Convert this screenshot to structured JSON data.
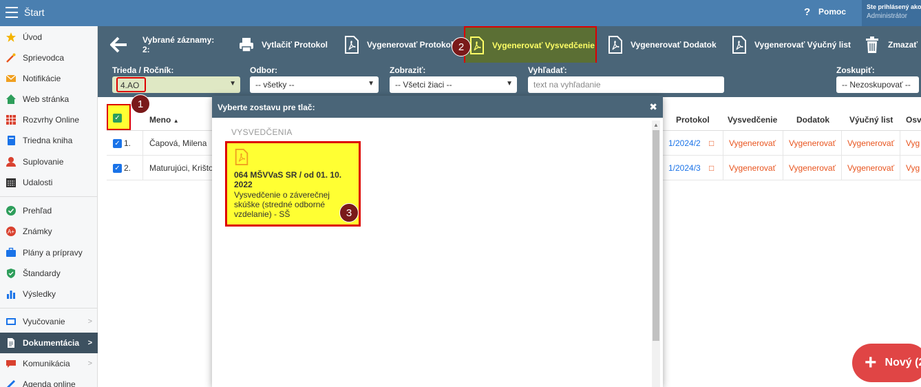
{
  "topbar": {
    "title": "Štart",
    "help_label": "Pomoc",
    "user_line1": "Ste prihlásený ako",
    "user_role": "Administrátor"
  },
  "sidebar": {
    "items": [
      {
        "label": "Úvod",
        "icon": "star-icon",
        "color": "#f4b400"
      },
      {
        "label": "Sprievodca",
        "icon": "wand-icon",
        "color": "#e8541e"
      },
      {
        "label": "Notifikácie",
        "icon": "envelope-icon",
        "color": "#f0a020"
      },
      {
        "label": "Web stránka",
        "icon": "home-icon",
        "color": "#2e9e5b"
      },
      {
        "label": "Rozvrhy Online",
        "icon": "calendar-grid-icon",
        "color": "#d9412f"
      },
      {
        "label": "Triedna kniha",
        "icon": "book-icon",
        "color": "#1a73e8"
      },
      {
        "label": "Suplovanie",
        "icon": "person-icon",
        "color": "#d9412f"
      },
      {
        "label": "Udalosti",
        "icon": "calendar-icon",
        "color": "#333333"
      },
      {
        "label": "Prehľad",
        "icon": "check-circle-icon",
        "color": "#2e9e5b"
      },
      {
        "label": "Známky",
        "icon": "grade-icon",
        "color": "#d9412f"
      },
      {
        "label": "Plány a prípravy",
        "icon": "briefcase-icon",
        "color": "#1a73e8"
      },
      {
        "label": "Štandardy",
        "icon": "shield-icon",
        "color": "#2e9e5b"
      },
      {
        "label": "Výsledky",
        "icon": "bar-chart-icon",
        "color": "#1a73e8"
      },
      {
        "label": "Vyučovanie",
        "icon": "classroom-icon",
        "color": "#1a73e8"
      },
      {
        "label": "Dokumentácia",
        "icon": "document-icon",
        "color": "#ffffff"
      },
      {
        "label": "Komunikácia",
        "icon": "chat-icon",
        "color": "#d9412f"
      },
      {
        "label": "Agenda online",
        "icon": "pen-icon",
        "color": "#1a73e8"
      }
    ]
  },
  "toolbar": {
    "selected_label": "Vybrané záznamy:",
    "selected_count": "2:",
    "print_protocol": "Vytlačiť Protokol",
    "gen_protocol": "Vygenerovať Protokol",
    "gen_certificate": "Vygenerovať Vysvedčenie",
    "gen_addendum": "Vygenerovať Dodatok",
    "gen_apprentice": "Vygenerovať Výučný list",
    "delete": "Zmazať"
  },
  "filters": {
    "class_label": "Trieda / Ročník:",
    "class_value": "4.AO",
    "field_label": "Odbor:",
    "field_value": "-- všetky --",
    "show_label": "Zobraziť:",
    "show_value": "-- Všetci žiaci --",
    "search_label": "Vyhľadať:",
    "search_placeholder": "text na vyhľadanie",
    "group_label": "Zoskupiť:",
    "group_value": "-- Nezoskupovať --"
  },
  "table": {
    "col_name": "Meno",
    "col_protocol": "Protokol",
    "col_certificate": "Vysvedčenie",
    "col_addendum": "Dodatok",
    "col_apprentice": "Výučný list",
    "col_more": "Osv",
    "rows": [
      {
        "num": "1.",
        "name": "Čapová, Milena",
        "protocol": "1/2024/2",
        "certificate": "Vygenerovať",
        "addendum": "Vygenerovať",
        "apprentice": "Vygenerovať",
        "more": "Vyg"
      },
      {
        "num": "2.",
        "name": "Maturujúci, Krišto",
        "protocol": "1/2024/3",
        "certificate": "Vygenerovať",
        "addendum": "Vygenerovať",
        "apprentice": "Vygenerovať",
        "more": "Vyg"
      }
    ]
  },
  "modal": {
    "title": "Vyberte zostavu pre tlač:",
    "section": "VYSVEDČENIA",
    "card_title": "064 MŠVVaS SR / od 01. 10. 2022",
    "card_desc": "Vysvedčenie o záverečnej skúške (stredné odborné vzdelanie) - SŠ"
  },
  "badges": {
    "b1": "1",
    "b2": "2",
    "b3": "3"
  },
  "fab": {
    "label": "Nový (2"
  }
}
